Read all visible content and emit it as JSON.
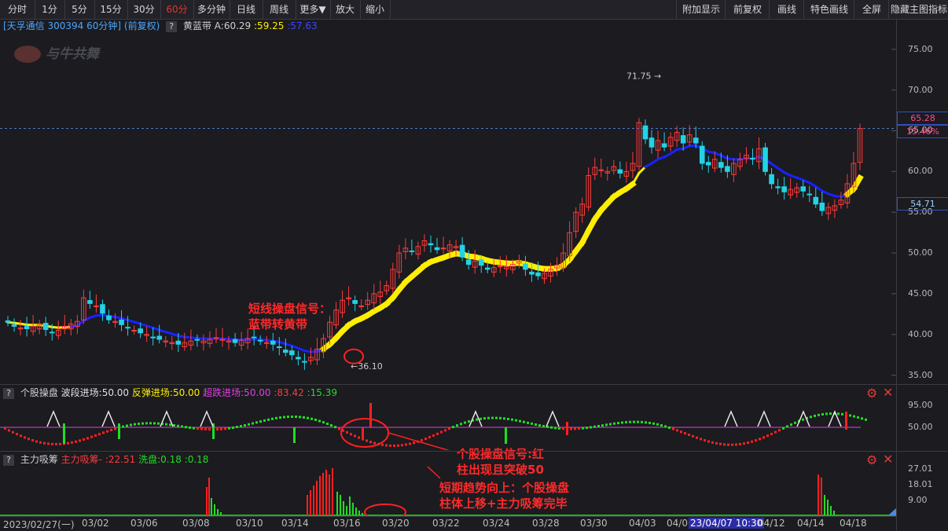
{
  "toolbar": {
    "left": [
      "分时",
      "1分",
      "5分",
      "15分",
      "30分",
      "60分",
      "多分钟",
      "日线",
      "周线",
      "更多▼",
      "放大",
      "缩小"
    ],
    "active": "60分",
    "right": [
      "附加显示",
      "前复权",
      "画线",
      "特色画线",
      "全屏",
      "隐藏主图指标"
    ]
  },
  "info": {
    "stock": "[天孚通信 300394 60分钟]",
    "adjust": "(前复权)",
    "q": "?",
    "indicator": "黄蓝带",
    "a_label": "A:60.29",
    "v1": ":59.25",
    "v2": ":57.63"
  },
  "watermark": "与牛共舞",
  "colors": {
    "up": "#ff3b3b",
    "down": "#22d3e6",
    "yellow": "#ffee00",
    "blue": "#1a22ff",
    "magenta": "#e040e0",
    "green": "#22dd22",
    "red": "#ff2020",
    "bg": "#1b1b20"
  },
  "annotations": {
    "a1": [
      "短线操盘信号：",
      "蓝带转黄带"
    ],
    "a2": [
      "个股操盘信号:红",
      "柱出现且突破50"
    ],
    "a3": [
      "短期趋势向上：个股操盘",
      "柱体上移+主力吸筹完毕"
    ]
  },
  "main_axis": {
    "ticks": [
      "75.00",
      "70.00",
      "65.00",
      "60.00",
      "55.00",
      "50.00",
      "45.00",
      "40.00",
      "35.00"
    ]
  },
  "price_tags": {
    "current": "65.28",
    "pct": "15.46%",
    "low_line": "54.71",
    "max_label": "71.75",
    "min_label": "36.10"
  },
  "panel2": {
    "q": "?",
    "name": "个股操盘",
    "l1": "波段进场:50.00",
    "l2": "反弹进场:50.00",
    "l3": "超跌进场:50.00",
    "l4": ":83.42",
    "l5": ":15.39",
    "ticks": [
      "95.00",
      "50.00"
    ]
  },
  "panel3": {
    "q": "?",
    "name": "主力吸筹",
    "l1": "主力吸筹-",
    "l2": ":22.51",
    "l3": "洗盘:0.18",
    "l4": ":0.18",
    "ticks": [
      "27.01",
      "18.01",
      "9.00"
    ]
  },
  "dates": [
    "2023/02/27(一)",
    "03/02",
    "03/06",
    "03/08",
    "03/10",
    "03/14",
    "03/16",
    "03/20",
    "03/22",
    "03/24",
    "03/28",
    "03/30",
    "04/03",
    "04/06",
    "23/04/07 10:30",
    "04/12",
    "04/14",
    "04/18"
  ],
  "chart_data": {
    "type": "candlestick",
    "ylim": [
      34,
      77
    ],
    "bars_close": [
      41.5,
      41.0,
      40.8,
      40.7,
      41.0,
      41.2,
      40.6,
      40.2,
      40.5,
      41.0,
      41.3,
      41.6,
      44.5,
      43.8,
      43.5,
      42.6,
      41.8,
      41.6,
      41.2,
      40.8,
      40.5,
      40.2,
      40.0,
      39.6,
      39.4,
      39.2,
      39.0,
      38.8,
      39.0,
      39.2,
      39.3,
      39.2,
      39.4,
      39.6,
      39.4,
      39.2,
      39.0,
      39.3,
      39.5,
      39.6,
      39.2,
      39.0,
      38.8,
      38.4,
      37.8,
      37.5,
      37.0,
      36.6,
      37.2,
      38.2,
      39.5,
      41.5,
      43.0,
      44.2,
      44.5,
      43.8,
      43.5,
      44.2,
      45.0,
      45.2,
      46.0,
      48.0,
      50.0,
      50.6,
      50.2,
      50.8,
      51.5,
      51.0,
      50.4,
      50.6,
      51.0,
      50.8,
      49.5,
      48.6,
      49.0,
      48.5,
      48.0,
      48.2,
      48.4,
      48.3,
      48.6,
      49.0,
      48.0,
      47.4,
      47.2,
      47.5,
      48.0,
      48.5,
      50.0,
      52.5,
      55.0,
      56.0,
      59.5,
      60.5,
      60.2,
      60.0,
      60.6,
      59.8,
      60.0,
      61.0,
      66.0,
      64.0,
      63.0,
      63.8,
      63.0,
      64.2,
      64.8,
      63.5,
      64.5,
      63.5,
      61.0,
      60.8,
      61.5,
      60.5,
      60.0,
      61.0,
      61.5,
      62.0,
      61.6,
      62.8,
      60.0,
      58.5,
      58.0,
      57.5,
      57.8,
      58.0,
      57.6,
      57.2,
      56.0,
      55.2,
      55.6,
      55.8,
      56.5,
      58.5,
      61.0,
      65.28
    ],
    "yellow_blue": {
      "blue_segments": [
        [
          11,
          50
        ],
        [
          102,
          133
        ]
      ]
    }
  }
}
